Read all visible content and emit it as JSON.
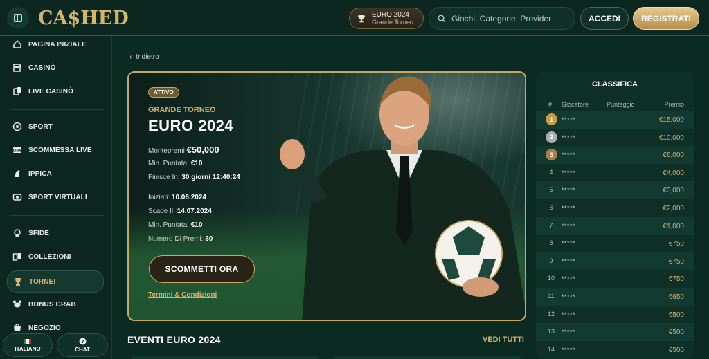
{
  "header": {
    "logo_text": "CA$HED",
    "promo": {
      "title": "EURO 2024",
      "subtitle": "Grande Torneo"
    },
    "search": {
      "placeholder": "Giochi, Categorie, Provider"
    },
    "login_label": "ACCEDI",
    "register_label": "REGISTRATI"
  },
  "sidebar": {
    "items": [
      {
        "label": "PAGINA INIZIALE",
        "icon": "home-icon"
      },
      {
        "label": "CASINÒ",
        "icon": "slot-machine-icon"
      },
      {
        "label": "LIVE CASINÒ",
        "icon": "cards-icon"
      },
      {
        "label": "SPORT",
        "icon": "ball-icon"
      },
      {
        "label": "SCOMMESSA LIVE",
        "icon": "live-icon"
      },
      {
        "label": "IPPICA",
        "icon": "horse-icon"
      },
      {
        "label": "SPORT VIRTUALI",
        "icon": "virtual-icon"
      },
      {
        "label": "SFIDE",
        "icon": "medal-icon"
      },
      {
        "label": "COLLEZIONI",
        "icon": "collection-icon"
      },
      {
        "label": "TORNEI",
        "icon": "trophy-icon"
      },
      {
        "label": "BONUS CRAB",
        "icon": "crab-icon"
      },
      {
        "label": "NEGOZIO",
        "icon": "shop-icon"
      }
    ],
    "active": "TORNEI",
    "language_label": "ITALIANO",
    "chat_label": "CHAT"
  },
  "main": {
    "back_label": "Indietro",
    "hero": {
      "status": "ATTIVO",
      "subtitle": "GRANDE TORNEO",
      "title": "EURO 2024",
      "prize_pool_label": "Montepremi",
      "prize_pool_value": "€50,000",
      "min_bet_label": "Min. Puntata:",
      "min_bet_value": "€10",
      "ends_label": "Finisce In:",
      "ends_value": "30 giorni 12:40:24",
      "started_label": "Iniziati:",
      "started_value": "10.06.2024",
      "expires_label": "Scade Il:",
      "expires_value": "14.07.2024",
      "min_bet2_label": "Min. Puntata:",
      "min_bet2_value": "€10",
      "prizes_count_label": "Numero Di Premi:",
      "prizes_count_value": "30",
      "cta_label": "SCOMMETTI ORA",
      "terms_label": "Termini & Condizioni"
    },
    "events_title": "EVENTI EURO 2024",
    "see_all_label": "VEDI TUTTI"
  },
  "leaderboard": {
    "title": "CLASSIFICA",
    "columns": [
      "#",
      "Giocatore",
      "Punteggio",
      "Premio"
    ],
    "rows": [
      {
        "rank": "1",
        "player": "*****",
        "prize": "€15,000"
      },
      {
        "rank": "2",
        "player": "*****",
        "prize": "€10,000"
      },
      {
        "rank": "3",
        "player": "*****",
        "prize": "€6,000"
      },
      {
        "rank": "4",
        "player": "*****",
        "prize": "€4,000"
      },
      {
        "rank": "5",
        "player": "*****",
        "prize": "€3,000"
      },
      {
        "rank": "6",
        "player": "*****",
        "prize": "€2,000"
      },
      {
        "rank": "7",
        "player": "*****",
        "prize": "€1,000"
      },
      {
        "rank": "8",
        "player": "*****",
        "prize": "€750"
      },
      {
        "rank": "9",
        "player": "*****",
        "prize": "€750"
      },
      {
        "rank": "10",
        "player": "*****",
        "prize": "€750"
      },
      {
        "rank": "11",
        "player": "*****",
        "prize": "€650"
      },
      {
        "rank": "12",
        "player": "*****",
        "prize": "€500"
      },
      {
        "rank": "13",
        "player": "*****",
        "prize": "€500"
      },
      {
        "rank": "14",
        "player": "*****",
        "prize": "€500"
      }
    ],
    "medal_colors": [
      "#c89a4a",
      "#a9aeb0",
      "#b07a45"
    ]
  },
  "colors": {
    "accent": "#d6b06a",
    "background": "#0b2a22"
  }
}
